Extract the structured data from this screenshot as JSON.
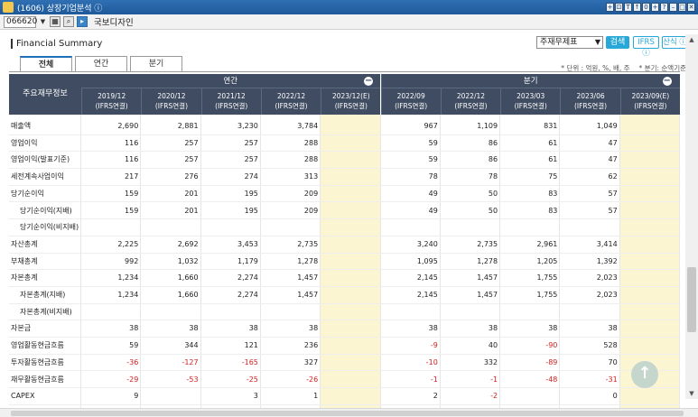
{
  "window": {
    "title": "(1606) 상장기업분석 ⓘ",
    "buttons": [
      "+",
      "⊡",
      "T",
      "↑",
      "0",
      "+",
      "?",
      "–",
      "□",
      "✕"
    ]
  },
  "toolbar": {
    "stock_code": "066620",
    "company_name": "국보디자인"
  },
  "panel": {
    "title": "Financial Summary",
    "select_value": "주재무제표",
    "search_label": "검색",
    "ifrs_label": "IFRS ⓘ",
    "method_label": "산식 ⓘ"
  },
  "tabs": [
    "전체",
    "연간",
    "분기"
  ],
  "notes": {
    "unit": "* 단위 : 억원, %, 배, 주",
    "quarter": "* 분기: 순액기준"
  },
  "table": {
    "row_header": "주요재무정보",
    "annual_label": "연간",
    "quarter_label": "분기",
    "columns": [
      {
        "period": "2019/12",
        "basis": "(IFRS연결)"
      },
      {
        "period": "2020/12",
        "basis": "(IFRS연결)"
      },
      {
        "period": "2021/12",
        "basis": "(IFRS연결)"
      },
      {
        "period": "2022/12",
        "basis": "(IFRS연결)"
      },
      {
        "period": "2023/12(E)",
        "basis": "(IFRS연결)"
      },
      {
        "period": "2022/09",
        "basis": "(IFRS연결)"
      },
      {
        "period": "2022/12",
        "basis": "(IFRS연결)"
      },
      {
        "period": "2023/03",
        "basis": "(IFRS연결)"
      },
      {
        "period": "2023/06",
        "basis": "(IFRS연결)"
      },
      {
        "period": "2023/09(E)",
        "basis": "(IFRS연결)"
      }
    ],
    "rows": [
      {
        "label": "매출액",
        "indent": false,
        "values": [
          "2,690",
          "2,881",
          "3,230",
          "3,784",
          "",
          "967",
          "1,109",
          "831",
          "1,049",
          ""
        ]
      },
      {
        "label": "영업이익",
        "indent": false,
        "values": [
          "116",
          "257",
          "257",
          "288",
          "",
          "59",
          "86",
          "61",
          "47",
          ""
        ]
      },
      {
        "label": "영업이익(발표기준)",
        "indent": false,
        "values": [
          "116",
          "257",
          "257",
          "288",
          "",
          "59",
          "86",
          "61",
          "47",
          ""
        ]
      },
      {
        "label": "세전계속사업이익",
        "indent": false,
        "values": [
          "217",
          "276",
          "274",
          "313",
          "",
          "78",
          "78",
          "75",
          "62",
          ""
        ]
      },
      {
        "label": "당기순이익",
        "indent": false,
        "values": [
          "159",
          "201",
          "195",
          "209",
          "",
          "49",
          "50",
          "83",
          "57",
          ""
        ]
      },
      {
        "label": "당기순이익(지배)",
        "indent": true,
        "values": [
          "159",
          "201",
          "195",
          "209",
          "",
          "49",
          "50",
          "83",
          "57",
          ""
        ]
      },
      {
        "label": "당기순이익(비지배)",
        "indent": true,
        "values": [
          "",
          "",
          "",
          "",
          "",
          "",
          "",
          "",
          "",
          ""
        ]
      },
      {
        "label": "자산총계",
        "indent": false,
        "values": [
          "2,225",
          "2,692",
          "3,453",
          "2,735",
          "",
          "3,240",
          "2,735",
          "2,961",
          "3,414",
          ""
        ]
      },
      {
        "label": "부채총계",
        "indent": false,
        "values": [
          "992",
          "1,032",
          "1,179",
          "1,278",
          "",
          "1,095",
          "1,278",
          "1,205",
          "1,392",
          ""
        ]
      },
      {
        "label": "자본총계",
        "indent": false,
        "values": [
          "1,234",
          "1,660",
          "2,274",
          "1,457",
          "",
          "2,145",
          "1,457",
          "1,755",
          "2,023",
          ""
        ]
      },
      {
        "label": "자본총계(지배)",
        "indent": true,
        "values": [
          "1,234",
          "1,660",
          "2,274",
          "1,457",
          "",
          "2,145",
          "1,457",
          "1,755",
          "2,023",
          ""
        ]
      },
      {
        "label": "자본총계(비지배)",
        "indent": true,
        "values": [
          "",
          "",
          "",
          "",
          "",
          "",
          "",
          "",
          "",
          ""
        ]
      },
      {
        "label": "자본금",
        "indent": false,
        "values": [
          "38",
          "38",
          "38",
          "38",
          "",
          "38",
          "38",
          "38",
          "38",
          ""
        ]
      },
      {
        "label": "영업활동현금흐름",
        "indent": false,
        "values": [
          "59",
          "344",
          "121",
          "236",
          "",
          "-9",
          "40",
          "-90",
          "528",
          ""
        ]
      },
      {
        "label": "투자활동현금흐름",
        "indent": false,
        "values": [
          "-36",
          "-127",
          "-165",
          "327",
          "",
          "-10",
          "332",
          "-89",
          "70",
          ""
        ]
      },
      {
        "label": "재무활동현금흐름",
        "indent": false,
        "values": [
          "-29",
          "-53",
          "-25",
          "-26",
          "",
          "-1",
          "-1",
          "-48",
          "-31",
          ""
        ]
      },
      {
        "label": "CAPEX",
        "indent": false,
        "values": [
          "9",
          "",
          "3",
          "1",
          "",
          "2",
          "-2",
          "",
          "0",
          ""
        ]
      }
    ]
  },
  "colors": {
    "header_bg": "#3f4c61",
    "accent": "#27a8d8",
    "estimate_bg": "#fbf5d2",
    "negative": "#d02020"
  },
  "icons": {
    "fab": "arrow-up-icon"
  }
}
